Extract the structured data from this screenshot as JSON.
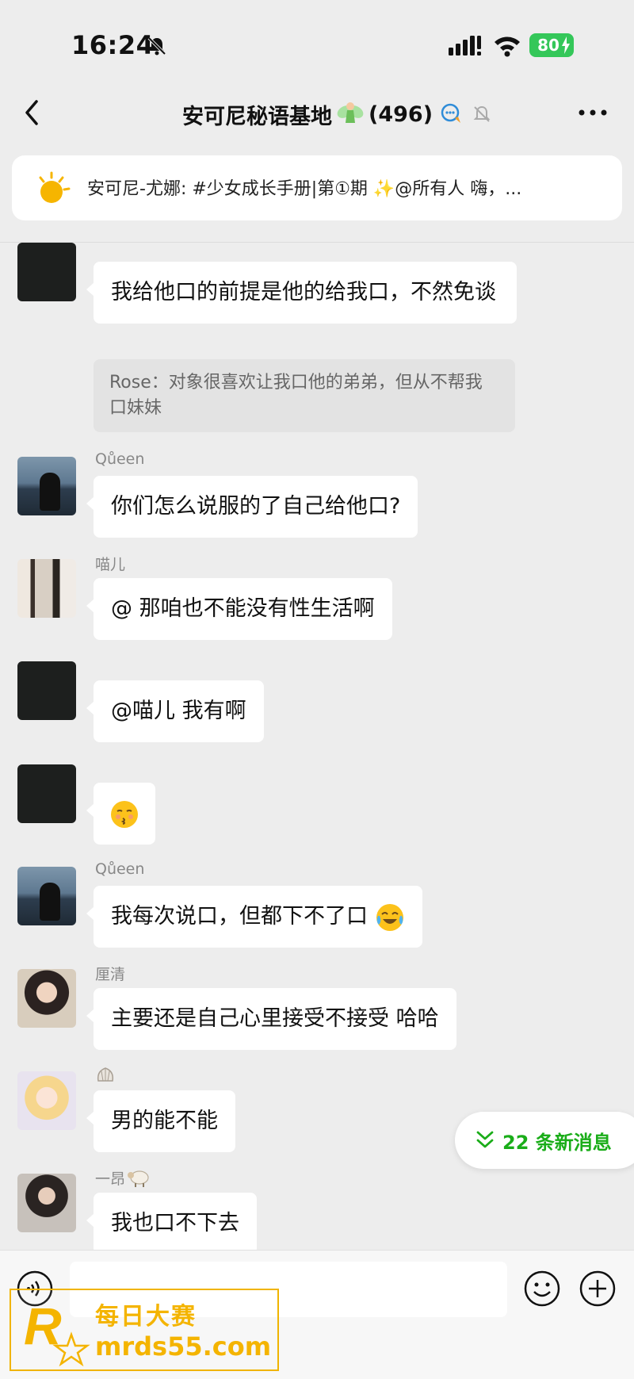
{
  "status_bar": {
    "time": "16:24",
    "battery": "80"
  },
  "nav": {
    "title": "安可尼秘语基地",
    "member_count": "(496)"
  },
  "announcement": {
    "text": "安可尼-尤娜: #少女成长手册|第①期 ✨@所有人  嗨，..."
  },
  "messages": [
    {
      "sender": "",
      "text": "我给他口的前提是他的给我口，不然免谈",
      "quote": "Rose：对象很喜欢让我口他的弟弟，但从不帮我口妹妹"
    },
    {
      "sender": "Qůeen",
      "text": "你们怎么说服的了自己给他口?"
    },
    {
      "sender": "喵儿",
      "text": "@ 那咱也不能没有性生活啊"
    },
    {
      "sender": "",
      "text": "@喵儿 我有啊"
    },
    {
      "sender": "",
      "text": "",
      "emoji": "kissing-face"
    },
    {
      "sender": "Qůeen",
      "text": "我每次说口，但都下不了口",
      "emoji": "crying-laughing-face"
    },
    {
      "sender": "厘清",
      "text": "主要还是自己心里接受不接受 哈哈"
    },
    {
      "sender": "",
      "text": "男的能不能"
    },
    {
      "sender": "一昂",
      "text": "我也口不下去"
    }
  ],
  "new_messages": {
    "label": "22 条新消息"
  },
  "watermark": {
    "cn": "每日大赛",
    "url": "mrds55.com"
  },
  "colors": {
    "accent_green": "#1aad19",
    "battery_green": "#34c759",
    "watermark_gold": "#f4b400"
  },
  "icons": [
    "mute-bell-icon",
    "signal-icon",
    "wifi-icon",
    "back-icon",
    "fairy-emoji",
    "chat-bubble-icon",
    "mute-icon",
    "more-icon",
    "sun-icon",
    "kissing-face-emoji",
    "crying-laughing-emoji",
    "chevrons-down-icon",
    "voice-icon",
    "smile-icon",
    "plus-icon"
  ]
}
